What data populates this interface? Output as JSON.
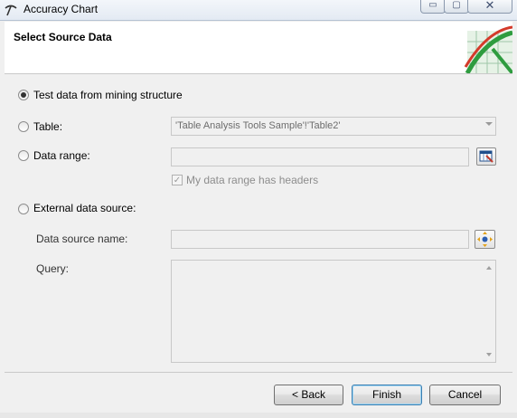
{
  "window": {
    "title": "Accuracy Chart",
    "minimize_glyph": "▭",
    "maximize_glyph": "▢",
    "close_glyph": "✕",
    "app_icon": "pickaxe-icon"
  },
  "header": {
    "title": "Select Source Data",
    "graphic": "chart-graphic"
  },
  "options": {
    "test_data": {
      "label": "Test data from mining structure",
      "selected": true
    },
    "table": {
      "label": "Table:",
      "selected": false,
      "value": "'Table Analysis Tools Sample'!'Table2'"
    },
    "data_range": {
      "label": "Data range:",
      "selected": false,
      "value": "",
      "picker_icon": "range-select-icon"
    },
    "headers_checkbox": {
      "label": "My data range has headers",
      "checked": true,
      "check_glyph": "✓"
    },
    "external": {
      "label": "External data source:",
      "selected": false
    },
    "data_source_name": {
      "label": "Data source name:",
      "value": "",
      "picker_icon": "connection-icon"
    },
    "query": {
      "label": "Query:",
      "value": ""
    }
  },
  "buttons": {
    "back": "< Back",
    "finish": "Finish",
    "cancel": "Cancel"
  },
  "colors": {
    "accent": "#3c7fb1",
    "chart_red": "#d43a2a",
    "chart_green": "#2e9c3f"
  }
}
